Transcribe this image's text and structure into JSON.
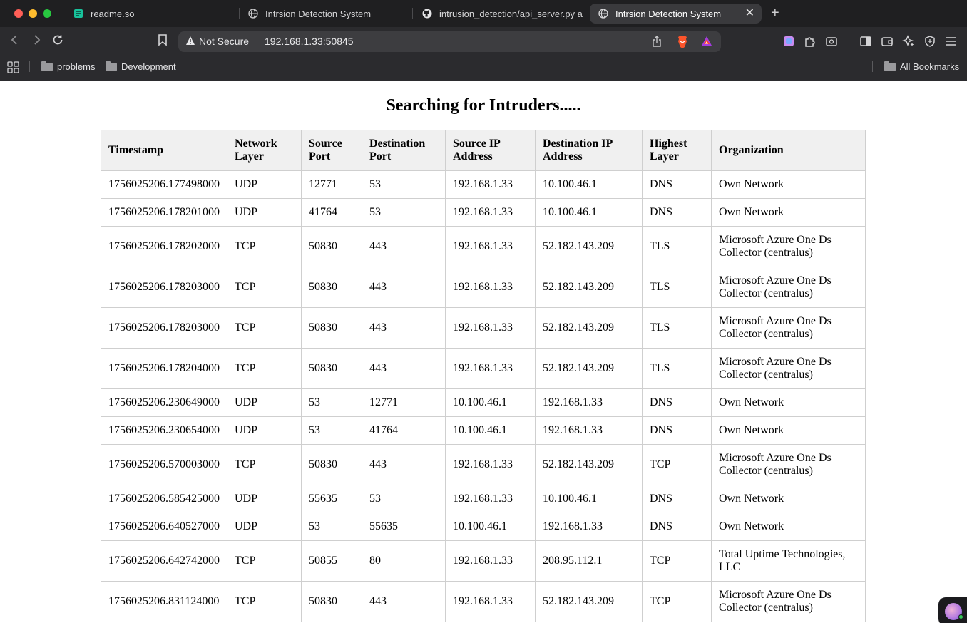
{
  "browser": {
    "tabs": [
      {
        "title": "readme.so",
        "active": false
      },
      {
        "title": "Intrsion Detection System",
        "active": false
      },
      {
        "title": "intrusion_detection/api_server.py a",
        "active": false
      },
      {
        "title": "Intrsion Detection System",
        "active": true
      }
    ],
    "close_tab_glyph": "✕",
    "new_tab_glyph": "+",
    "address_bar": {
      "security_label": "Not Secure",
      "url": "192.168.1.33:50845"
    },
    "bookmarks": [
      {
        "label": "problems"
      },
      {
        "label": "Development"
      }
    ],
    "all_bookmarks_label": "All Bookmarks"
  },
  "page": {
    "title": "Searching for Intruders.....",
    "table": {
      "headers": [
        "Timestamp",
        "Network Layer",
        "Source Port",
        "Destination Port",
        "Source IP Address",
        "Destination IP Address",
        "Highest Layer",
        "Organization"
      ],
      "rows": [
        [
          "1756025206.177498000",
          "UDP",
          "12771",
          "53",
          "192.168.1.33",
          "10.100.46.1",
          "DNS",
          "Own Network"
        ],
        [
          "1756025206.178201000",
          "UDP",
          "41764",
          "53",
          "192.168.1.33",
          "10.100.46.1",
          "DNS",
          "Own Network"
        ],
        [
          "1756025206.178202000",
          "TCP",
          "50830",
          "443",
          "192.168.1.33",
          "52.182.143.209",
          "TLS",
          "Microsoft Azure One Ds Collector (centralus)"
        ],
        [
          "1756025206.178203000",
          "TCP",
          "50830",
          "443",
          "192.168.1.33",
          "52.182.143.209",
          "TLS",
          "Microsoft Azure One Ds Collector (centralus)"
        ],
        [
          "1756025206.178203000",
          "TCP",
          "50830",
          "443",
          "192.168.1.33",
          "52.182.143.209",
          "TLS",
          "Microsoft Azure One Ds Collector (centralus)"
        ],
        [
          "1756025206.178204000",
          "TCP",
          "50830",
          "443",
          "192.168.1.33",
          "52.182.143.209",
          "TLS",
          "Microsoft Azure One Ds Collector (centralus)"
        ],
        [
          "1756025206.230649000",
          "UDP",
          "53",
          "12771",
          "10.100.46.1",
          "192.168.1.33",
          "DNS",
          "Own Network"
        ],
        [
          "1756025206.230654000",
          "UDP",
          "53",
          "41764",
          "10.100.46.1",
          "192.168.1.33",
          "DNS",
          "Own Network"
        ],
        [
          "1756025206.570003000",
          "TCP",
          "50830",
          "443",
          "192.168.1.33",
          "52.182.143.209",
          "TCP",
          "Microsoft Azure One Ds Collector (centralus)"
        ],
        [
          "1756025206.585425000",
          "UDP",
          "55635",
          "53",
          "192.168.1.33",
          "10.100.46.1",
          "DNS",
          "Own Network"
        ],
        [
          "1756025206.640527000",
          "UDP",
          "53",
          "55635",
          "10.100.46.1",
          "192.168.1.33",
          "DNS",
          "Own Network"
        ],
        [
          "1756025206.642742000",
          "TCP",
          "50855",
          "80",
          "192.168.1.33",
          "208.95.112.1",
          "TCP",
          "Total Uptime Technologies, LLC"
        ],
        [
          "1756025206.831124000",
          "TCP",
          "50830",
          "443",
          "192.168.1.33",
          "52.182.143.209",
          "TCP",
          "Microsoft Azure One Ds Collector (centralus)"
        ]
      ]
    }
  }
}
